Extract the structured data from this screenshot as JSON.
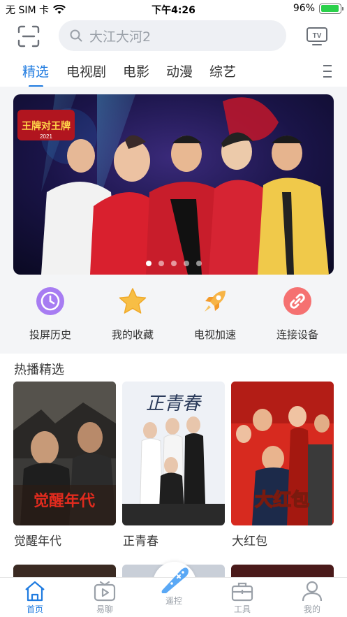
{
  "status_bar": {
    "carrier": "无 SIM 卡",
    "time": "下午4:26",
    "battery": "96%",
    "battery_level": 0.96
  },
  "search": {
    "placeholder": "大江大河2"
  },
  "tv_button": {
    "label": "TV"
  },
  "tabs": [
    {
      "label": "精选",
      "active": true
    },
    {
      "label": "电视剧",
      "active": false
    },
    {
      "label": "电影",
      "active": false
    },
    {
      "label": "动漫",
      "active": false
    },
    {
      "label": "综艺",
      "active": false
    }
  ],
  "banner": {
    "logo_text": "王牌对王牌",
    "year": "2021",
    "slide_count": 5,
    "active_slide": 0
  },
  "actions": [
    {
      "label": "投屏历史",
      "icon": "clock-icon",
      "color": "#9b6ae8"
    },
    {
      "label": "我的收藏",
      "icon": "star-icon",
      "color": "#f6b93b"
    },
    {
      "label": "电视加速",
      "icon": "rocket-icon",
      "color": "#f6a93b"
    },
    {
      "label": "连接设备",
      "icon": "link-icon",
      "color": "#f56b6b"
    }
  ],
  "section": {
    "title": "热播精选",
    "items": [
      {
        "title": "觉醒年代",
        "poster_text": "觉醒年代"
      },
      {
        "title": "正青春",
        "poster_text": "正青春"
      },
      {
        "title": "大红包",
        "poster_text": "大红包"
      }
    ]
  },
  "tabbar": [
    {
      "label": "首页",
      "icon": "home-icon",
      "active": true
    },
    {
      "label": "易聊",
      "icon": "chat-tv-icon",
      "active": false
    },
    {
      "label": "遥控",
      "icon": "remote-icon",
      "active": false
    },
    {
      "label": "工具",
      "icon": "toolbox-icon",
      "active": false
    },
    {
      "label": "我的",
      "icon": "user-icon",
      "active": false
    }
  ],
  "colors": {
    "accent": "#1f7be0",
    "inactive": "#9aa0a8"
  }
}
